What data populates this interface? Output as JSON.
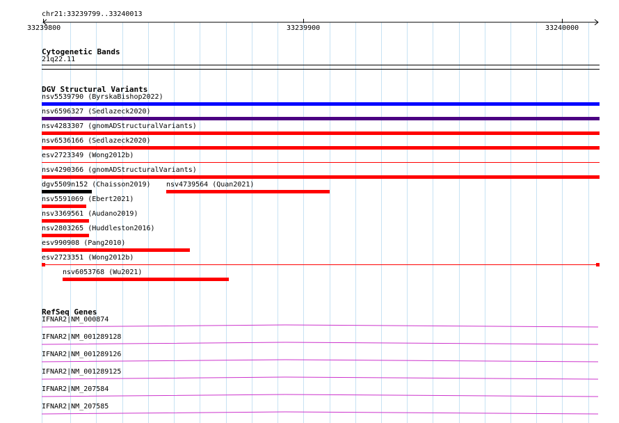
{
  "ruler": {
    "region": "chr21:33239799..33240013",
    "ticks": [
      "33239800",
      "33239900",
      "33240000"
    ]
  },
  "cyto": {
    "title": "Cytogenetic Bands",
    "band": "21q22.11"
  },
  "dgv": {
    "title": "DGV Structural Variants",
    "colors": {
      "blue": "#0000ff",
      "purple": "#4b0082",
      "red": "#ff0000",
      "black": "#000000"
    },
    "features": [
      {
        "id": "nsv5539790",
        "label": "nsv5539790 (ByrskaBishop2022)",
        "color": "blue"
      },
      {
        "id": "nsv6596327",
        "label": "nsv6596327 (Sedlazeck2020)",
        "color": "purple"
      },
      {
        "id": "nsv4283307",
        "label": "nsv4283307 (gnomADStructuralVariants)",
        "color": "red"
      },
      {
        "id": "nsv6536166",
        "label": "nsv6536166 (Sedlazeck2020)",
        "color": "red"
      },
      {
        "id": "esv2723349",
        "label": "esv2723349 (Wong2012b)",
        "color": "red"
      },
      {
        "id": "nsv4290366",
        "label": "nsv4290366 (gnomADStructuralVariants)",
        "color": "red"
      },
      {
        "id": "dgv5509n152",
        "label": "dgv5509n152 (Chaisson2019)",
        "color": "black"
      },
      {
        "id": "nsv4739564",
        "label": "nsv4739564 (Quan2021)",
        "color": "red"
      },
      {
        "id": "nsv5591069",
        "label": "nsv5591069 (Ebert2021)",
        "color": "red"
      },
      {
        "id": "nsv3369561",
        "label": "nsv3369561 (Audano2019)",
        "color": "red"
      },
      {
        "id": "nsv2803265",
        "label": "nsv2803265 (Huddleston2016)",
        "color": "red"
      },
      {
        "id": "esv990908",
        "label": "esv990908 (Pang2010)",
        "color": "red"
      },
      {
        "id": "esv2723351",
        "label": "esv2723351 (Wong2012b)",
        "color": "red"
      },
      {
        "id": "nsv6053768",
        "label": "nsv6053768 (Wu2021)",
        "color": "red"
      }
    ]
  },
  "refseq": {
    "title": "RefSeq Genes",
    "intron_color": "#cc33cc",
    "transcripts": [
      {
        "label": "IFNAR2|NM_000874"
      },
      {
        "label": "IFNAR2|NM_001289128"
      },
      {
        "label": "IFNAR2|NM_001289126"
      },
      {
        "label": "IFNAR2|NM_001289125"
      },
      {
        "label": "IFNAR2|NM_207584"
      },
      {
        "label": "IFNAR2|NM_207585"
      }
    ]
  }
}
